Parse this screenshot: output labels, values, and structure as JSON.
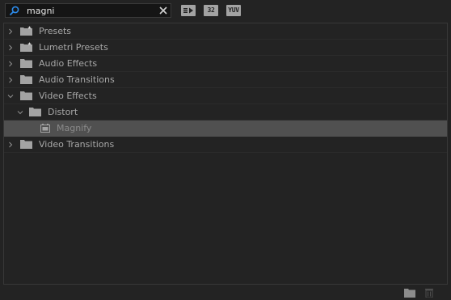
{
  "search": {
    "value": "magni",
    "placeholder": ""
  },
  "toolbar": {
    "accelerated_label": "",
    "bit32_label": "32",
    "yuv_label": "YUV"
  },
  "tree": {
    "items": [
      {
        "label": "Presets",
        "expanded": false,
        "icon": "preset-folder-icon"
      },
      {
        "label": "Lumetri Presets",
        "expanded": false,
        "icon": "preset-folder-icon"
      },
      {
        "label": "Audio Effects",
        "expanded": false,
        "icon": "folder-icon"
      },
      {
        "label": "Audio Transitions",
        "expanded": false,
        "icon": "folder-icon"
      },
      {
        "label": "Video Effects",
        "expanded": true,
        "icon": "folder-icon"
      },
      {
        "label": "Distort",
        "expanded": true,
        "icon": "folder-icon"
      },
      {
        "label": "Magnify",
        "selected": true,
        "icon": "effect-icon"
      },
      {
        "label": "Video Transitions",
        "expanded": false,
        "icon": "folder-icon"
      }
    ]
  },
  "colors": {
    "background": "#232323",
    "selection": "#505050",
    "search_icon": "#2d8ceb"
  }
}
